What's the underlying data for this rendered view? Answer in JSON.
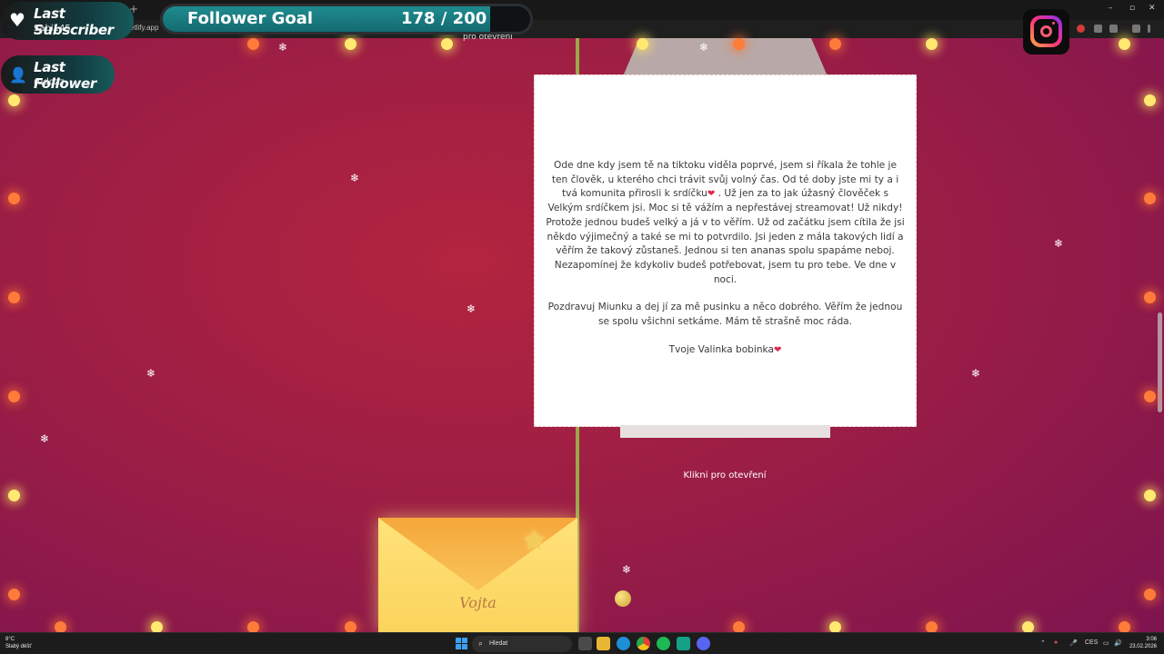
{
  "browser": {
    "url_fragment": "etlify.app",
    "new_tab_label": "+"
  },
  "page": {
    "behind_text": "pro otevření",
    "click_hint": "Klikni pro otevření",
    "letter": {
      "paragraph1": "Ode dne kdy jsem tě na tiktoku viděla poprvé, jsem si říkala že tohle je ten člověk, u kterého chci trávit svůj volný čas. Od té doby jste mi ty a i tvá komunita přirosli k srdíčku",
      "paragraph1b": ". Už jen za to jak úžasný člověček s Velkým srdíčkem jsi. Moc si tě vážím a nepřestávej streamovat! Už nikdy! Protože jednou budeš velký a já v to věřím. Už od začátku jsem cítila že jsi někdo výjimečný a také se mi to potvrdilo. Jsi jeden z mála takových lidí a věřím že takový zůstaneš. Jednou si ten ananas spolu spapáme neboj. Nezapomínej že kdykoliv budeš potřebovat, jsem tu pro tebe. Ve dne v noci.",
      "paragraph2": "Pozdravuj Miunku a dej jí za mě pusinku a něco dobrého. Věřím že jednou se spolu všichni setkáme. Mám tě strašně moc ráda.",
      "signature": "Tvoje Valinka bobinka",
      "heart_glyph": "❤"
    },
    "envelope_name": "Vojta"
  },
  "overlay": {
    "last_subscriber": {
      "title": "Last Subscriber",
      "name": "Sabi145"
    },
    "last_follower": {
      "title": "Last Follower",
      "name": "rudozz"
    },
    "follower_goal": {
      "label": "Follower Goal",
      "count_text": "178 / 200",
      "current": 178,
      "target": 200
    },
    "social_icon": "instagram-icon"
  },
  "taskbar": {
    "weather_temp": "8°C",
    "weather_desc": "Slabý déšť",
    "search_placeholder": "Hledat",
    "language": "CES",
    "time": "3:06",
    "date": "23.02.2026",
    "apps": [
      "start-icon",
      "task-view-icon",
      "file-explorer-icon",
      "edge-icon",
      "chrome-icon",
      "spotify-icon",
      "app-icon",
      "discord-icon"
    ]
  },
  "colors": {
    "background": "#9c1e45",
    "goal_fill": "#1f8c8f",
    "envelope": "#fbd45c",
    "heart": "#e0284f"
  }
}
